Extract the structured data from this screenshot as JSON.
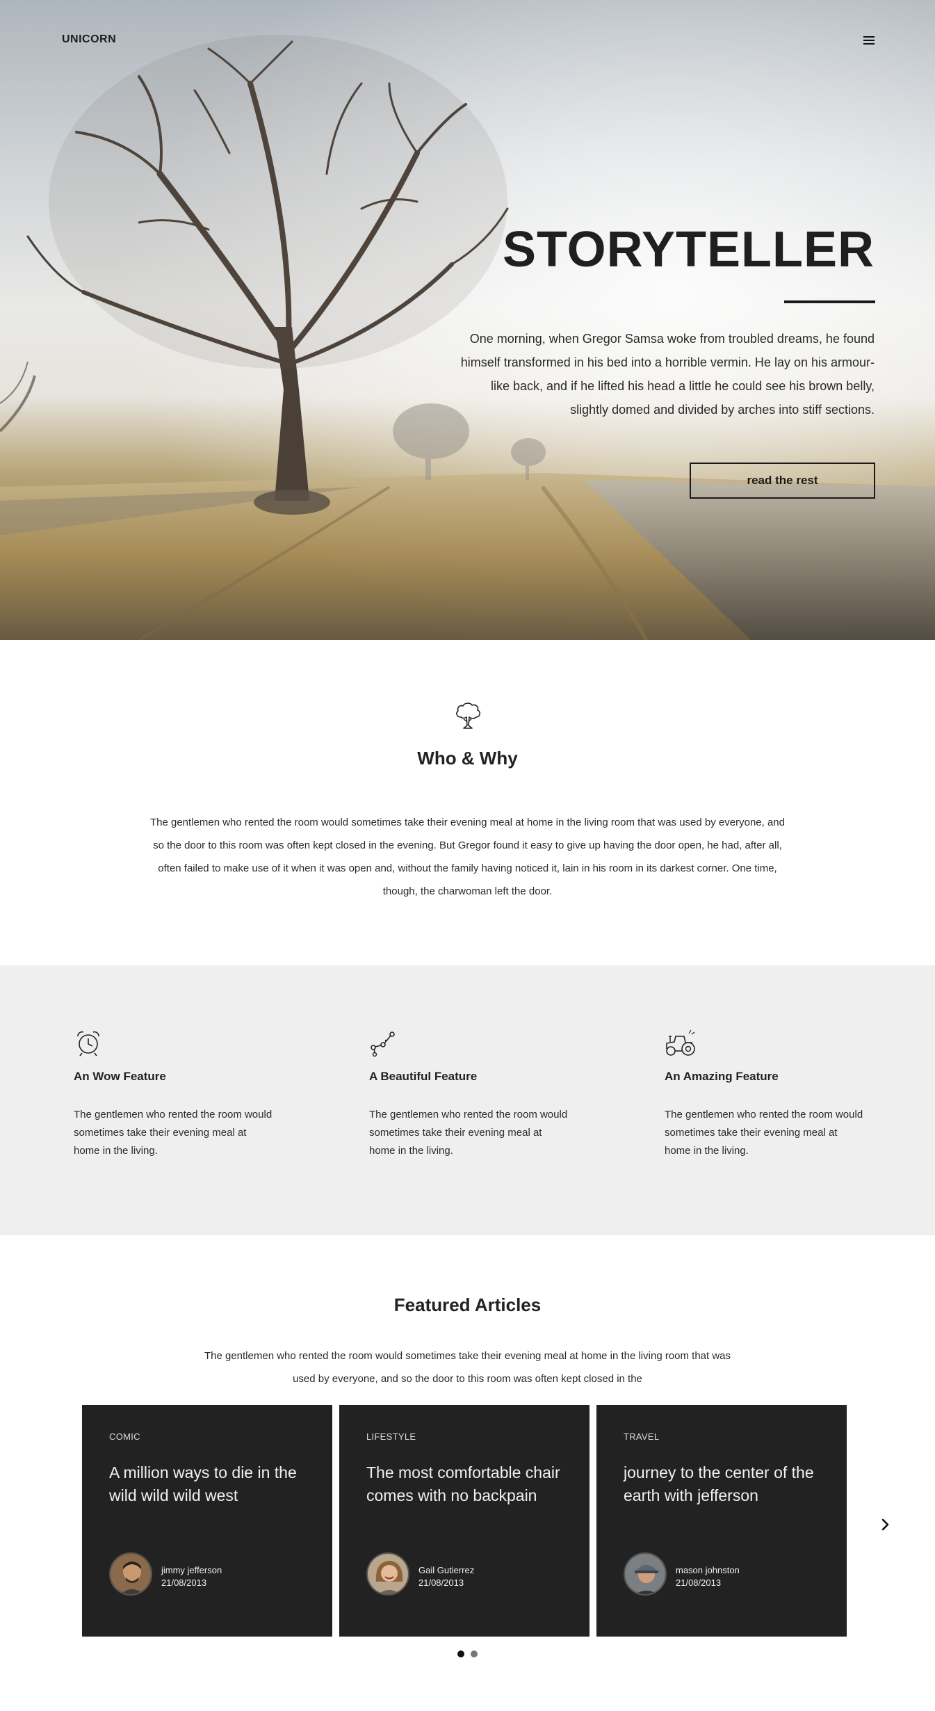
{
  "header": {
    "brand": "UNICORN",
    "menu_icon": "hamburger-menu-icon"
  },
  "hero": {
    "title": "STORYTELLER",
    "text": "One morning, when Gregor Samsa woke from troubled dreams, he found himself transformed in his bed into a horrible vermin. He lay on his armour-like back, and if he lifted his head a little he could see his brown belly, slightly domed and divided by arches into stiff sections.",
    "button_label": "read the rest",
    "image": "misty-tree-field-photo"
  },
  "who": {
    "icon": "tree-icon",
    "title": "Who & Why",
    "text": "The gentlemen who rented the room would sometimes take their evening meal at home in the living room that was used by everyone, and so the door to this room was often kept closed in the evening. But Gregor found it easy to give up having the door open, he had, after all, often failed to make use of it when it was open and, without the family having noticed it, lain in his room in its darkest corner. One time, though, the charwoman left the door."
  },
  "features": [
    {
      "icon": "alarm-clock-icon",
      "title": "An Wow Feature",
      "text": "The gentlemen who rented the room would sometimes take their evening meal at home in the living."
    },
    {
      "icon": "path-nodes-icon",
      "title": "A Beautiful Feature",
      "text": "The gentlemen who rented the room would sometimes take their evening meal at home in the living."
    },
    {
      "icon": "tractor-icon",
      "title": "An Amazing Feature",
      "text": "The gentlemen who rented the room would sometimes take their evening meal at home in the living."
    }
  ],
  "featured": {
    "title": "Featured Articles",
    "text": "The gentlemen who rented the room would sometimes take their evening meal at home in the living room that was used by everyone, and so the door to this room was often kept closed in the",
    "articles": [
      {
        "category": "COMIC",
        "title": "A million ways to die in the wild wild wild west",
        "author": "jimmy jefferson",
        "date": "21/08/2013"
      },
      {
        "category": "LIFESTYLE",
        "title": "The most comfortable chair comes with no backpain",
        "author": "Gail Gutierrez",
        "date": "21/08/2013"
      },
      {
        "category": "TRAVEL",
        "title": "journey to the center of the earth with jefferson",
        "author": "mason johnston",
        "date": "21/08/2013"
      }
    ],
    "next_icon": "chevron-right-icon",
    "pagination": {
      "pages": 2,
      "active": 1
    },
    "colors": {
      "card_bg": "#222222",
      "section_bg": "#efefef"
    }
  }
}
